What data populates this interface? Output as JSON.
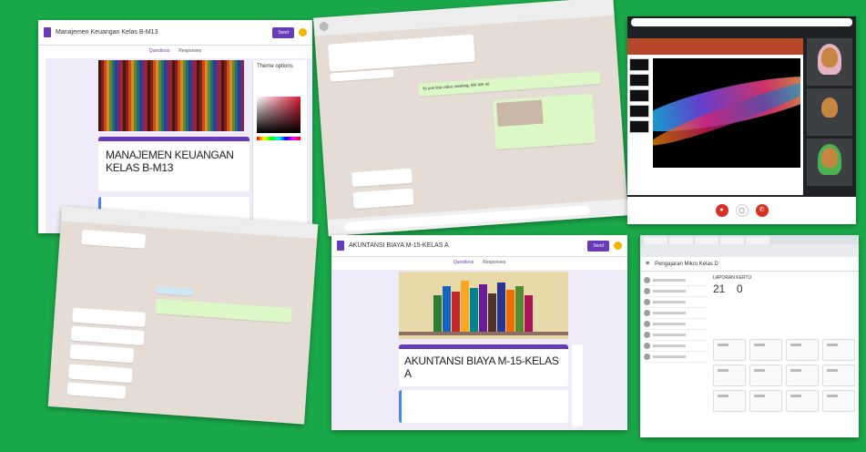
{
  "form1": {
    "title": "Manajemen Keuangan Kelas B-M13",
    "send": "Send",
    "tab_questions": "Questions",
    "tab_responses": "Responses",
    "form_title": "MANAJEMEN KEUANGAN KELAS B-M13",
    "theme_options": "Theme options"
  },
  "chat1": {
    "out_message": "Yo yuk kita video meeting, klik link ini:"
  },
  "zoom": {},
  "form2": {
    "title": "AKUNTANSI BIAYA M-15-KELAS A",
    "send": "Send",
    "tab_questions": "Questions",
    "tab_responses": "Responses",
    "form_title": "AKUNTANSI BIAYA M-15-KELAS A"
  },
  "classroom": {
    "class_name": "Pengajaran Mikro Kelas D",
    "report_title": "LAPORAN KERTU",
    "count_a": "21",
    "count_b": "0"
  },
  "colors": {
    "background": "#1aa94a",
    "forms_accent": "#673ab7",
    "chat_bg": "#e5ddd5",
    "chat_out": "#dcf8c6"
  }
}
